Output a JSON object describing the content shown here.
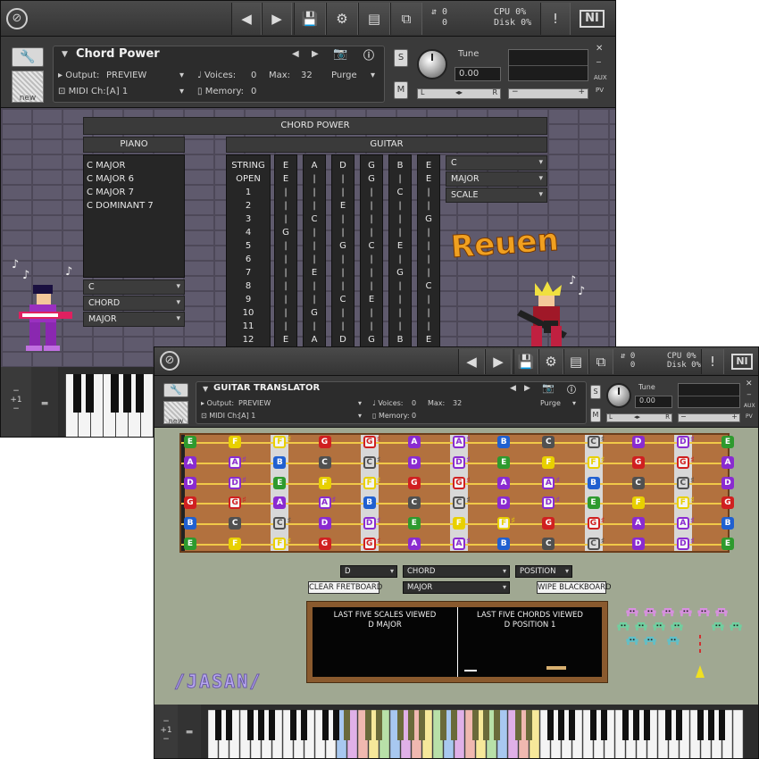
{
  "win1": {
    "toolbar": {
      "cpu_label": "CPU",
      "cpu_value": "0%",
      "disk_label": "Disk",
      "disk_value": "0%",
      "voices_top": "0",
      "voices_bottom": "0",
      "ni_label": "NI",
      "alert": "!"
    },
    "header": {
      "title": "Chord Power",
      "output_label": "Output:",
      "output_value": "PREVIEW",
      "voices_label": "Voices:",
      "voices_value": "0",
      "max_label": "Max:",
      "max_value": "32",
      "midi_label": "MIDI Ch:",
      "midi_value": "[A]  1",
      "memory_label": "Memory:",
      "memory_value": "0",
      "purge_label": "Purge",
      "tune_label": "Tune",
      "tune_value": "0.00",
      "s_label": "S",
      "m_label": "M",
      "l_label": "L",
      "r_label": "R",
      "aux_label": "AUX",
      "pv_label": "PV",
      "new_label": "new"
    },
    "chord_power": {
      "title": "CHORD POWER",
      "piano_label": "PIANO",
      "guitar_label": "GUITAR",
      "piano_items": [
        "C MAJOR",
        "C MAJOR 6",
        "C MAJOR 7",
        "C DOMINANT 7"
      ],
      "piano_dd1": "C",
      "piano_dd2": "CHORD",
      "piano_dd3": "MAJOR",
      "guitar_dd1": "C",
      "guitar_dd2": "MAJOR",
      "guitar_dd3": "SCALE",
      "guitar_rows": [
        "STRING",
        "OPEN",
        "1",
        "2",
        "3",
        "4",
        "5",
        "6",
        "7",
        "8",
        "9",
        "10",
        "11",
        "12"
      ],
      "guitar_strings": [
        [
          "E",
          "E",
          "|",
          "|",
          "|",
          "G",
          "|",
          "|",
          "|",
          "|",
          "|",
          "|",
          "|",
          "E"
        ],
        [
          "A",
          "|",
          "|",
          "|",
          "C",
          "|",
          "|",
          "|",
          "E",
          "|",
          "|",
          "G",
          "|",
          "A"
        ],
        [
          "D",
          "|",
          "|",
          "E",
          "|",
          "|",
          "G",
          "|",
          "|",
          "|",
          "C",
          "|",
          "|",
          "D"
        ],
        [
          "G",
          "G",
          "|",
          "|",
          "|",
          "|",
          "C",
          "|",
          "|",
          "|",
          "E",
          "|",
          "|",
          "G"
        ],
        [
          "B",
          "|",
          "C",
          "|",
          "|",
          "|",
          "E",
          "|",
          "G",
          "|",
          "|",
          "|",
          "|",
          "B"
        ],
        [
          "E",
          "E",
          "|",
          "|",
          "G",
          "|",
          "|",
          "|",
          "|",
          "C",
          "|",
          "|",
          "|",
          "E"
        ]
      ],
      "logo_text": "Reuen"
    },
    "keyboard": {
      "octave_label": "+1"
    }
  },
  "win2": {
    "toolbar": {
      "cpu_label": "CPU",
      "cpu_value": "0%",
      "disk_label": "Disk",
      "disk_value": "0%",
      "voices_top": "0",
      "voices_bottom": "0",
      "ni_label": "NI",
      "alert": "!"
    },
    "header": {
      "title": "GUITAR TRANSLATOR",
      "output_label": "Output:",
      "output_value": "PREVIEW",
      "voices_label": "Voices:",
      "voices_value": "0",
      "max_label": "Max:",
      "max_value": "32",
      "midi_label": "MIDI Ch:",
      "midi_value": "[A]  1",
      "memory_label": "Memory:",
      "memory_value": "0",
      "purge_label": "Purge",
      "tune_label": "Tune",
      "tune_value": "0.00",
      "s_label": "S",
      "m_label": "M",
      "l_label": "L",
      "r_label": "R",
      "aux_label": "AUX",
      "pv_label": "PV",
      "new_label": "new"
    },
    "fretboard": {
      "strings": [
        [
          "E",
          "F",
          "F#",
          "G",
          "G#",
          "A",
          "A#",
          "B",
          "C",
          "C#",
          "D",
          "D#",
          "E"
        ],
        [
          "A",
          "A#",
          "B",
          "C",
          "C#",
          "D",
          "D#",
          "E",
          "F",
          "F#",
          "G",
          "G#",
          "A"
        ],
        [
          "D",
          "D#",
          "E",
          "F",
          "F#",
          "G",
          "G#",
          "A",
          "A#",
          "B",
          "C",
          "C#",
          "D"
        ],
        [
          "G",
          "G#",
          "A",
          "A#",
          "B",
          "C",
          "C#",
          "D",
          "D#",
          "E",
          "F",
          "F#",
          "G"
        ],
        [
          "B",
          "C",
          "C#",
          "D",
          "D#",
          "E",
          "F",
          "F#",
          "G",
          "G#",
          "A",
          "A#",
          "B"
        ],
        [
          "E",
          "F",
          "F#",
          "G",
          "G#",
          "A",
          "A#",
          "B",
          "C",
          "C#",
          "D",
          "D#",
          "E"
        ]
      ],
      "note_colors": {
        "C": "#505050",
        "D": "#8a2bd0",
        "E": "#2e9a2e",
        "F": "#e8d000",
        "G": "#d02020",
        "A": "#8a2bd0",
        "B": "#2060d0"
      }
    },
    "controls": {
      "key_dd": "D",
      "chord_dd": "CHORD",
      "position_dd": "POSITION",
      "type_dd": "MAJOR",
      "clear_btn": "CLEAR FRETBOARD",
      "wipe_btn": "WIPE BLACKBOARD"
    },
    "blackboard": {
      "scales_heading": "LAST FIVE SCALES VIEWED",
      "scales_item": "D MAJOR",
      "chords_heading": "LAST FIVE CHORDS VIEWED",
      "chords_item": "D  POSITION 1"
    },
    "logo_text": "/JASAN/",
    "keyboard": {
      "octave_label": "+1"
    }
  }
}
